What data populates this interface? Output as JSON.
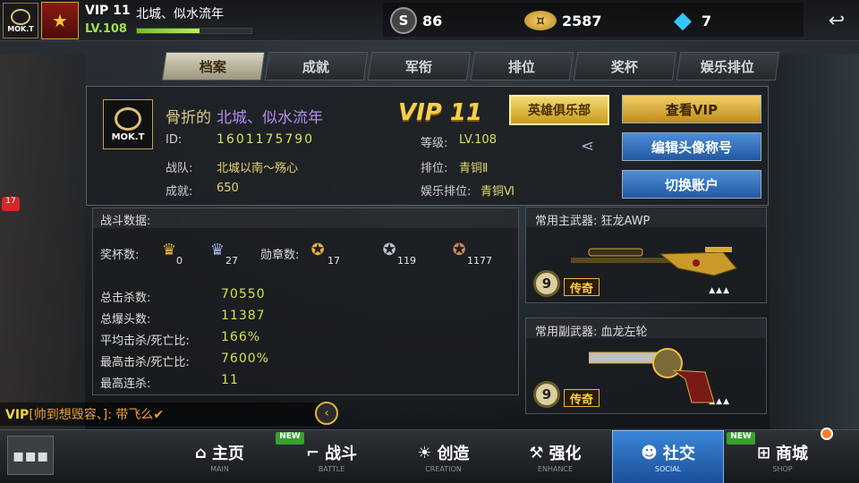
{
  "header": {
    "clan_tag": "MOK.T",
    "vip": "VIP 11",
    "name": "北城、似水流年",
    "level": "LV.108",
    "xp_progress": 0.55,
    "currencies": [
      {
        "icon": "s-medal-icon",
        "label": "S",
        "value": "86"
      },
      {
        "icon": "gold-coin-icon",
        "label": "",
        "value": "2587"
      },
      {
        "icon": "diamond-icon",
        "label": "",
        "value": "7"
      }
    ]
  },
  "tabs": [
    "档案",
    "成就",
    "军衔",
    "排位",
    "奖杯",
    "娱乐排位"
  ],
  "active_tab": 0,
  "profile": {
    "avatar_tag": "MOK.T",
    "title_prefix": "骨折的",
    "name": "北城、似水流年",
    "vip": "VIP 11",
    "id_label": "ID:",
    "id_value": "1601175790",
    "team_label": "战队:",
    "team_value": "北城以南～殇心",
    "achievement_label": "成就:",
    "achievement_value": "650",
    "level_label": "等级:",
    "level_value": "LV.108",
    "rank_label": "排位:",
    "rank_value": "青铜Ⅱ",
    "fun_rank_label": "娱乐排位:",
    "fun_rank_value": "青铜Ⅵ",
    "hero_club_button": "英雄俱乐部",
    "view_vip_button": "查看VIP",
    "edit_avatar_button": "编辑头像称号",
    "switch_account_button": "切换账户"
  },
  "stats": {
    "title": "战斗数据:",
    "trophy_label": "奖杯数:",
    "trophies": [
      "0",
      "27"
    ],
    "medal_label": "勋章数:",
    "medals": [
      "17",
      "119",
      "1177"
    ],
    "rows": [
      {
        "label": "总击杀数:",
        "value": "70550"
      },
      {
        "label": "总爆头数:",
        "value": "11387"
      },
      {
        "label": "平均击杀/死亡比:",
        "value": "166%"
      },
      {
        "label": "最高击杀/死亡比:",
        "value": "7600%"
      },
      {
        "label": "最高连杀:",
        "value": "11"
      }
    ]
  },
  "weapons": {
    "primary": {
      "title": "常用主武器: 狂龙AWP",
      "level": "9",
      "rarity": "传奇",
      "stars": "▲▲▲"
    },
    "secondary": {
      "title": "常用副武器: 血龙左轮",
      "level": "9",
      "rarity": "传奇",
      "stars": "▲▲▲"
    }
  },
  "chat": {
    "vip": "VIP",
    "user": "[帅到想毁容、]:",
    "message": "带飞么✔"
  },
  "side_badge": "17",
  "nav": {
    "items": [
      {
        "label": "主页",
        "sub": "MAIN",
        "icon": "home-icon"
      },
      {
        "label": "战斗",
        "sub": "BATTLE",
        "icon": "gun-icon",
        "badge": "NEW"
      },
      {
        "label": "创造",
        "sub": "CREATION",
        "icon": "bulb-icon"
      },
      {
        "label": "强化",
        "sub": "ENHANCE",
        "icon": "hammer-icon"
      },
      {
        "label": "社交",
        "sub": "SOCIAL",
        "icon": "people-icon"
      },
      {
        "label": "商城",
        "sub": "SHOP",
        "icon": "cart-icon",
        "badge": "NEW"
      }
    ],
    "active": 4
  },
  "colors": {
    "accent_gold": "#f4d04b",
    "accent_blue": "#2f7fd0",
    "stat_value": "#d4e04c"
  }
}
